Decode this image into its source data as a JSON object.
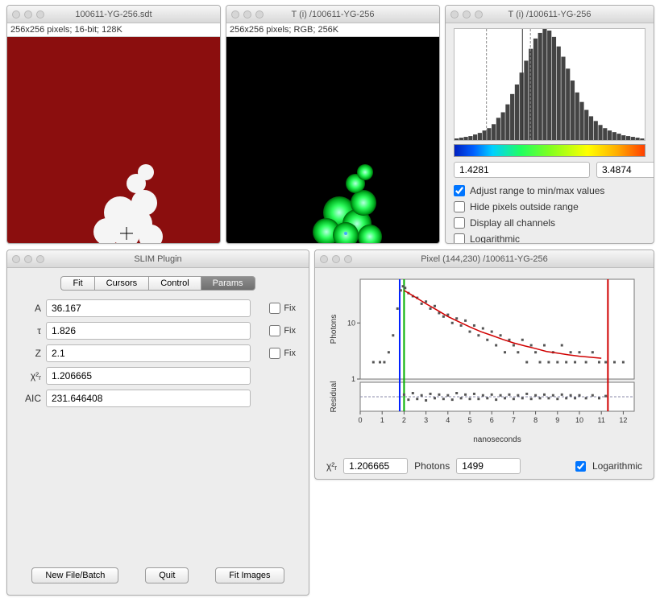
{
  "windows": {
    "raw": {
      "title": "100611-YG-256.sdt",
      "info": "256x256 pixels; 16-bit; 128K"
    },
    "rgb": {
      "title": "T (i) /100611-YG-256",
      "info": "256x256 pixels; RGB; 256K"
    },
    "hist": {
      "title": "T (i) /100611-YG-256",
      "range_min": "1.4281",
      "range_max": "3.4874",
      "checks": {
        "adjust": "Adjust range to min/max values",
        "hide": "Hide pixels outside range",
        "display_all": "Display all channels",
        "log": "Logarithmic"
      }
    },
    "slim": {
      "title": "SLIM Plugin",
      "tabs": [
        "Fit",
        "Cursors",
        "Control",
        "Params"
      ],
      "active_tab": 3,
      "params": {
        "A": "36.167",
        "tau": "1.826",
        "Z": "2.1",
        "chi2r": "1.206665",
        "AIC": "231.646408"
      },
      "labels": {
        "A": "A",
        "tau": "τ",
        "Z": "Z",
        "chi2r": "χ²ᵣ",
        "AIC": "AIC",
        "fix": "Fix"
      },
      "buttons": {
        "newfile": "New File/Batch",
        "quit": "Quit",
        "fit": "Fit Images"
      }
    },
    "pixel": {
      "title": "Pixel (144,230) /100611-YG-256",
      "y1_label": "Photons",
      "y2_label": "Residual",
      "x_label": "nanoseconds",
      "chi2r_label": "χ²ᵣ",
      "chi2r": "1.206665",
      "photons_label": "Photons",
      "photons": "1499",
      "log": "Logarithmic"
    }
  },
  "chart_data": [
    {
      "type": "histogram",
      "title": "Lifetime histogram",
      "xlim": [
        1.4281,
        3.4874
      ],
      "bars": [
        2,
        3,
        4,
        5,
        7,
        9,
        12,
        15,
        20,
        28,
        35,
        45,
        58,
        70,
        85,
        100,
        115,
        128,
        135,
        140,
        138,
        130,
        118,
        105,
        90,
        75,
        60,
        48,
        38,
        30,
        24,
        19,
        15,
        12,
        10,
        8,
        6,
        5,
        4,
        3,
        2
      ]
    },
    {
      "type": "scatter+line",
      "title": "Decay curve",
      "xlabel": "nanoseconds",
      "ylabel": "Photons",
      "yscale": "log",
      "xlim": [
        0,
        12.5
      ],
      "ylim": [
        1,
        60
      ],
      "cursors": {
        "blue": 1.8,
        "green": 2.0,
        "red": 11.3
      },
      "fit": [
        {
          "x": 2.0,
          "y": 38
        },
        {
          "x": 2.5,
          "y": 29
        },
        {
          "x": 3.0,
          "y": 22
        },
        {
          "x": 3.5,
          "y": 17
        },
        {
          "x": 4.0,
          "y": 13
        },
        {
          "x": 4.5,
          "y": 10.5
        },
        {
          "x": 5.0,
          "y": 8.5
        },
        {
          "x": 5.5,
          "y": 7.0
        },
        {
          "x": 6.0,
          "y": 6.0
        },
        {
          "x": 6.5,
          "y": 5.1
        },
        {
          "x": 7.0,
          "y": 4.4
        },
        {
          "x": 7.5,
          "y": 3.9
        },
        {
          "x": 8.0,
          "y": 3.5
        },
        {
          "x": 8.5,
          "y": 3.1
        },
        {
          "x": 9.0,
          "y": 2.9
        },
        {
          "x": 9.5,
          "y": 2.7
        },
        {
          "x": 10.0,
          "y": 2.55
        },
        {
          "x": 10.5,
          "y": 2.45
        },
        {
          "x": 11.0,
          "y": 2.35
        }
      ],
      "points": [
        {
          "x": 0.6,
          "y": 2
        },
        {
          "x": 0.9,
          "y": 2
        },
        {
          "x": 1.1,
          "y": 2
        },
        {
          "x": 1.3,
          "y": 3
        },
        {
          "x": 1.5,
          "y": 6
        },
        {
          "x": 1.7,
          "y": 18
        },
        {
          "x": 1.85,
          "y": 38
        },
        {
          "x": 1.95,
          "y": 45
        },
        {
          "x": 2.05,
          "y": 42
        },
        {
          "x": 2.2,
          "y": 34
        },
        {
          "x": 2.4,
          "y": 30
        },
        {
          "x": 2.6,
          "y": 28
        },
        {
          "x": 2.8,
          "y": 22
        },
        {
          "x": 3.0,
          "y": 24
        },
        {
          "x": 3.2,
          "y": 18
        },
        {
          "x": 3.4,
          "y": 20
        },
        {
          "x": 3.6,
          "y": 15
        },
        {
          "x": 3.8,
          "y": 13
        },
        {
          "x": 4.0,
          "y": 14
        },
        {
          "x": 4.2,
          "y": 10
        },
        {
          "x": 4.4,
          "y": 12
        },
        {
          "x": 4.6,
          "y": 9
        },
        {
          "x": 4.8,
          "y": 11
        },
        {
          "x": 5.0,
          "y": 7
        },
        {
          "x": 5.2,
          "y": 9
        },
        {
          "x": 5.4,
          "y": 6
        },
        {
          "x": 5.6,
          "y": 8
        },
        {
          "x": 5.8,
          "y": 5
        },
        {
          "x": 6.0,
          "y": 7
        },
        {
          "x": 6.2,
          "y": 4
        },
        {
          "x": 6.4,
          "y": 6
        },
        {
          "x": 6.6,
          "y": 3
        },
        {
          "x": 6.8,
          "y": 5
        },
        {
          "x": 7.0,
          "y": 4
        },
        {
          "x": 7.2,
          "y": 3
        },
        {
          "x": 7.4,
          "y": 5
        },
        {
          "x": 7.6,
          "y": 2
        },
        {
          "x": 7.8,
          "y": 4
        },
        {
          "x": 8.0,
          "y": 3
        },
        {
          "x": 8.2,
          "y": 2
        },
        {
          "x": 8.4,
          "y": 4
        },
        {
          "x": 8.6,
          "y": 2
        },
        {
          "x": 8.8,
          "y": 3
        },
        {
          "x": 9.0,
          "y": 2
        },
        {
          "x": 9.2,
          "y": 4
        },
        {
          "x": 9.4,
          "y": 2
        },
        {
          "x": 9.6,
          "y": 3
        },
        {
          "x": 9.8,
          "y": 2
        },
        {
          "x": 10.0,
          "y": 3
        },
        {
          "x": 10.3,
          "y": 2
        },
        {
          "x": 10.6,
          "y": 3
        },
        {
          "x": 10.9,
          "y": 2
        },
        {
          "x": 11.2,
          "y": 2
        },
        {
          "x": 11.6,
          "y": 2
        },
        {
          "x": 12.0,
          "y": 2
        }
      ]
    },
    {
      "type": "scatter",
      "title": "Residuals",
      "xlabel": "nanoseconds",
      "ylabel": "Residual",
      "xlim": [
        0,
        12.5
      ],
      "ylim": [
        -2,
        2
      ],
      "x": [
        2.0,
        2.2,
        2.4,
        2.6,
        2.8,
        3.0,
        3.2,
        3.4,
        3.6,
        3.8,
        4.0,
        4.2,
        4.4,
        4.6,
        4.8,
        5.0,
        5.2,
        5.4,
        5.6,
        5.8,
        6.0,
        6.2,
        6.4,
        6.6,
        6.8,
        7.0,
        7.2,
        7.4,
        7.6,
        7.8,
        8.0,
        8.2,
        8.4,
        8.6,
        8.8,
        9.0,
        9.2,
        9.4,
        9.6,
        9.8,
        10.0,
        10.3,
        10.6,
        10.9,
        11.2
      ],
      "y": [
        0.3,
        -0.4,
        0.5,
        -0.3,
        0.2,
        -0.5,
        0.4,
        -0.2,
        0.3,
        -0.3,
        0.2,
        -0.4,
        0.5,
        -0.2,
        0.3,
        -0.3,
        0.4,
        -0.3,
        0.2,
        -0.2,
        0.3,
        -0.4,
        0.2,
        -0.2,
        0.3,
        -0.3,
        0.2,
        -0.2,
        0.4,
        -0.3,
        0.2,
        -0.2,
        0.3,
        -0.2,
        0.2,
        -0.3,
        0.3,
        -0.2,
        0.2,
        -0.2,
        0.2,
        -0.2,
        0.2,
        -0.2,
        0.1
      ]
    }
  ]
}
